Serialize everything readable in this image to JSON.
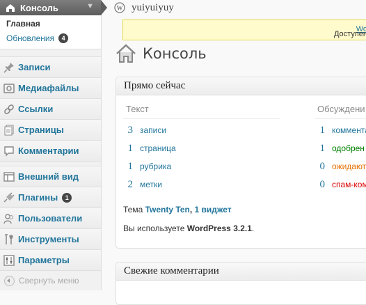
{
  "site_title": "yuiyuiyuy",
  "notice": {
    "prefix": "Доступен ",
    "link": "Wo"
  },
  "page_title": "Консоль",
  "sidebar": {
    "dashboard": {
      "label": "Консоль",
      "sub": [
        {
          "label": "Главная"
        },
        {
          "label": "Обновления",
          "count": "4"
        }
      ]
    },
    "items": [
      {
        "label": "Записи",
        "icon": "pin-icon"
      },
      {
        "label": "Медиафайлы",
        "icon": "media-icon"
      },
      {
        "label": "Ссылки",
        "icon": "link-icon"
      },
      {
        "label": "Страницы",
        "icon": "pages-icon"
      },
      {
        "label": "Комментарии",
        "icon": "comment-icon"
      },
      {
        "label": "Внешний вид",
        "icon": "appearance-icon"
      },
      {
        "label": "Плагины",
        "icon": "plugin-icon",
        "count": "1"
      },
      {
        "label": "Пользователи",
        "icon": "users-icon"
      },
      {
        "label": "Инструменты",
        "icon": "tools-icon"
      },
      {
        "label": "Параметры",
        "icon": "settings-icon"
      }
    ],
    "collapse": "Свернуть меню"
  },
  "right_now": {
    "title": "Прямо сейчас",
    "content_header": "Текст",
    "discussion_header": "Обсуждени",
    "content": [
      {
        "num": "3",
        "label": "записи"
      },
      {
        "num": "1",
        "label": "страница"
      },
      {
        "num": "1",
        "label": "рубрика"
      },
      {
        "num": "2",
        "label": "метки"
      }
    ],
    "discussion": [
      {
        "num": "1",
        "label": "коммента"
      },
      {
        "num": "1",
        "label": "одобрен"
      },
      {
        "num": "0",
        "label": "ожидают"
      },
      {
        "num": "0",
        "label": "спам-ком"
      }
    ],
    "theme_prefix": "Тема ",
    "theme_name": "Twenty Ten",
    "theme_sep": ", ",
    "widgets": "1 виджет",
    "version_prefix": "Вы используете ",
    "version": "WordPress 3.2.1",
    "version_suffix": "."
  },
  "recent_comments": {
    "title": "Свежие комментарии"
  }
}
